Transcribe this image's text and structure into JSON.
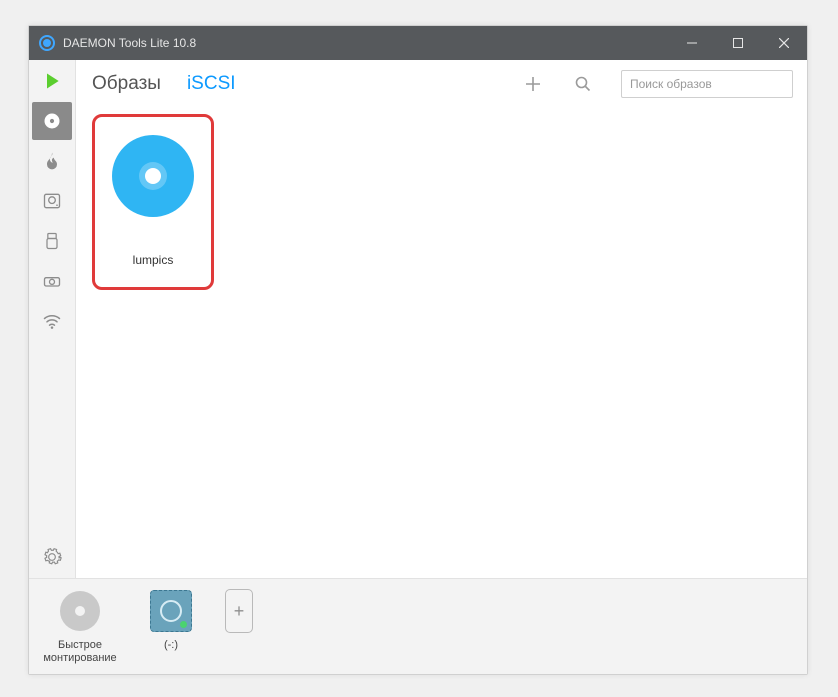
{
  "window": {
    "title": "DAEMON Tools Lite 10.8"
  },
  "tabs": {
    "images": "Образы",
    "iscsi": "iSCSI"
  },
  "search": {
    "placeholder": "Поиск образов"
  },
  "catalog": {
    "items": [
      {
        "name": "lumpics"
      }
    ]
  },
  "bottom": {
    "quick_mount": "Быстрое\nмонтирование",
    "drive_label": "(-:)"
  },
  "sidebar": {
    "items": [
      {
        "id": "play",
        "name": "Quick Mount"
      },
      {
        "id": "images",
        "name": "Images"
      },
      {
        "id": "burn",
        "name": "Burn"
      },
      {
        "id": "hdd",
        "name": "Drives"
      },
      {
        "id": "usb",
        "name": "USB"
      },
      {
        "id": "iscsi-drive",
        "name": "Virtual HDD"
      },
      {
        "id": "share",
        "name": "Share"
      },
      {
        "id": "settings",
        "name": "Settings"
      }
    ]
  },
  "colors": {
    "accent": "#2fb5f3",
    "highlight_border": "#e03a3a",
    "play": "#5bce2f"
  }
}
